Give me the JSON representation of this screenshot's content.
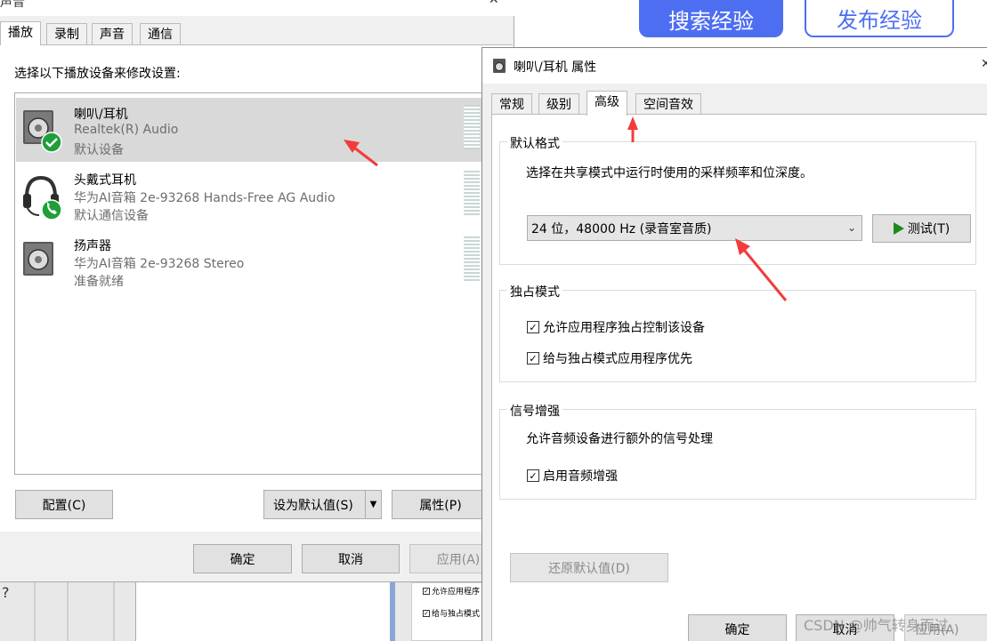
{
  "web": {
    "search_button": "搜索经验",
    "publish_button": "发布经验"
  },
  "sound_dialog": {
    "title": "声音",
    "tabs": [
      "播放",
      "录制",
      "声音",
      "通信"
    ],
    "instruction": "选择以下播放设备来修改设置:",
    "devices": [
      {
        "name": "喇叭/耳机",
        "driver": "Realtek(R) Audio",
        "status": "默认设备",
        "icon": "speaker-icon",
        "badge": "check-badge-icon"
      },
      {
        "name": "头戴式耳机",
        "driver": "华为AI音箱 2e-93268 Hands-Free AG Audio",
        "status": "默认通信设备",
        "icon": "headset-icon",
        "badge": "phone-badge-icon"
      },
      {
        "name": "扬声器",
        "driver": "华为AI音箱 2e-93268 Stereo",
        "status": "准备就绪",
        "icon": "speaker-icon"
      }
    ],
    "buttons": {
      "configure": "配置(C)",
      "set_default": "设为默认值(S)",
      "properties": "属性(P)",
      "ok": "确定",
      "cancel": "取消",
      "apply": "应用(A)"
    }
  },
  "properties_dialog": {
    "title": "喇叭/耳机 属性",
    "tabs": [
      "常规",
      "级别",
      "高级",
      "空间音效"
    ],
    "default_format": {
      "label": "默认格式",
      "description": "选择在共享模式中运行时使用的采样频率和位深度。",
      "selected": "24 位，48000 Hz (录音室音质)",
      "test_button": "测试(T)"
    },
    "exclusive_mode": {
      "label": "独占模式",
      "options": [
        {
          "label": "允许应用程序独占控制该设备",
          "checked": true
        },
        {
          "label": "给与独占模式应用程序优先",
          "checked": true
        }
      ]
    },
    "signal_enhancement": {
      "label": "信号增强",
      "description": "允许音频设备进行额外的信号处理",
      "option": {
        "label": "启用音频增强",
        "checked": true
      }
    },
    "restore_button": "还原默认值(D)",
    "ok": "确定",
    "cancel": "取消",
    "apply": "应用(A)"
  },
  "background": {
    "help": "?",
    "mini_options": [
      "允许应用程序",
      "给与独占模式"
    ]
  },
  "watermark": "CSDN @帅气转身而过",
  "colors": {
    "accent_blue": "#4e6ef2",
    "annotation_red": "#f23c3c",
    "check_green": "#1f9e3a",
    "selection_gray": "#d9d9d9"
  }
}
